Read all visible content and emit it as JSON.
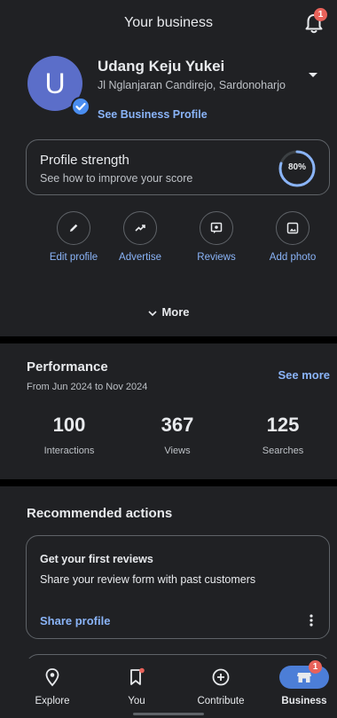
{
  "header": {
    "title": "Your business",
    "notification_count": "1"
  },
  "business": {
    "avatar_letter": "U",
    "name": "Udang Keju Yukei",
    "address": "Jl Nglanjaran Candirejo, Sardonoharjo",
    "profile_link": "See Business Profile"
  },
  "profile_strength": {
    "title": "Profile strength",
    "subtitle": "See how to improve your score",
    "percent_label": "80%",
    "percent": 80
  },
  "actions": [
    {
      "label": "Edit profile",
      "icon": "pencil-icon"
    },
    {
      "label": "Advertise",
      "icon": "trend-icon"
    },
    {
      "label": "Reviews",
      "icon": "review-icon"
    },
    {
      "label": "Add photo",
      "icon": "photo-icon"
    }
  ],
  "more_label": "More",
  "performance": {
    "title": "Performance",
    "period": "From Jun 2024 to Nov 2024",
    "see_more": "See more",
    "stats": [
      {
        "value": "100",
        "label": "Interactions"
      },
      {
        "value": "367",
        "label": "Views"
      },
      {
        "value": "125",
        "label": "Searches"
      }
    ]
  },
  "recommended": {
    "title": "Recommended actions",
    "card": {
      "title": "Get your first reviews",
      "text": "Share your review form with past customers",
      "link": "Share profile"
    }
  },
  "nav": {
    "items": [
      {
        "label": "Explore",
        "icon": "location-pin-icon"
      },
      {
        "label": "You",
        "icon": "bookmark-icon"
      },
      {
        "label": "Contribute",
        "icon": "add-circle-icon"
      },
      {
        "label": "Business",
        "icon": "storefront-icon"
      }
    ],
    "business_badge": "1",
    "active": "Business"
  },
  "colors": {
    "background": "#202124",
    "accent": "#8ab4f8",
    "active_nav": "#4c7ed7",
    "badge": "#e8625a",
    "avatar": "#5b6ec9"
  }
}
